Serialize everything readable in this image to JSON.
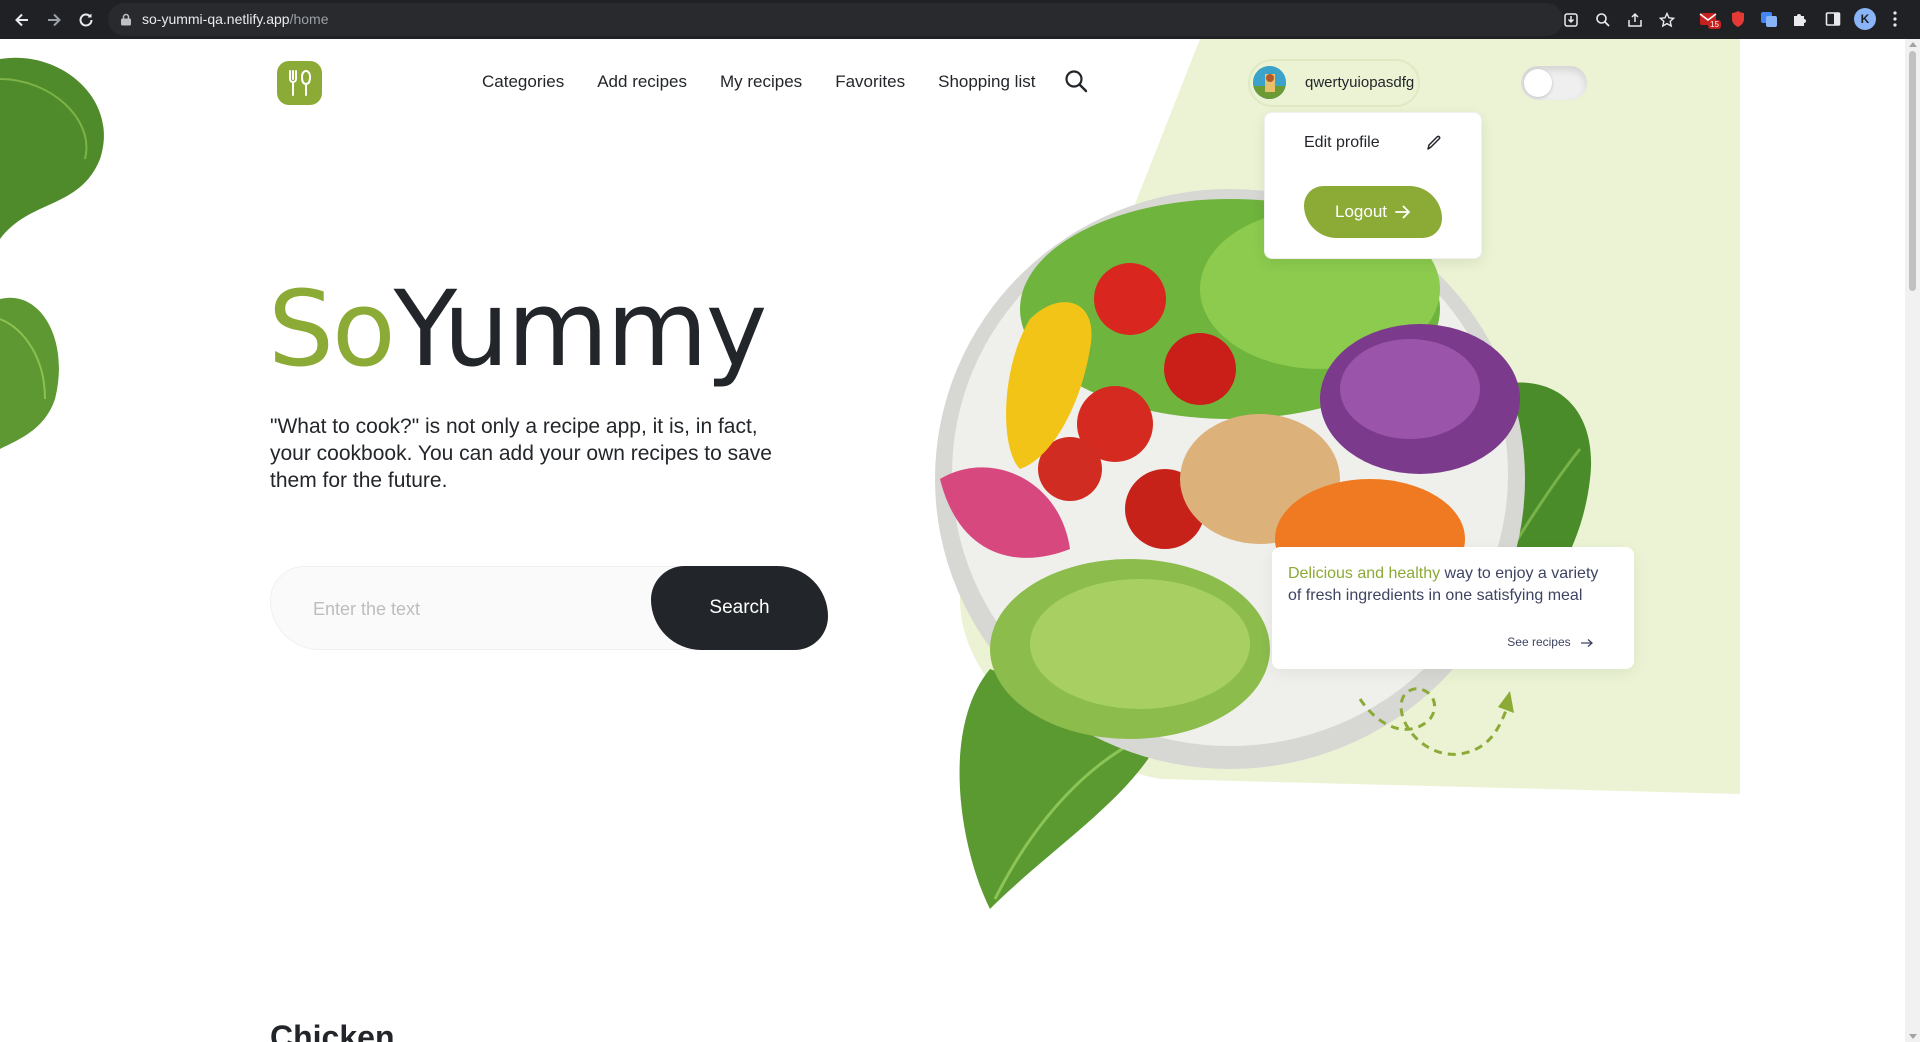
{
  "browser": {
    "url_host": "so-yummi-qa.netlify.app",
    "url_path": "/home",
    "extension_badge": "15",
    "profile_initial": "K"
  },
  "header": {
    "nav": [
      "Categories",
      "Add recipes",
      "My recipes",
      "Favorites",
      "Shopping list"
    ],
    "user_name": "qwertyuiopasdfg"
  },
  "user_menu": {
    "edit_label": "Edit profile",
    "logout_label": "Logout"
  },
  "hero": {
    "title_part1": "So",
    "title_part2": "Yummy",
    "description": "\"What to cook?\" is not only a recipe app, it is, in fact, your cookbook. You can add your own recipes to save them for the future.",
    "search_placeholder": "Enter the text",
    "search_button": "Search"
  },
  "info_card": {
    "accent_text": "Delicious and healthy",
    "rest_text": " way to enjoy a variety of fresh ingredients in one satisfying meal",
    "link_label": "See recipes"
  },
  "next_section_title": "Chicken",
  "colors": {
    "accent": "#8baa36",
    "dark": "#22252a",
    "light_green": "#ebf3d4"
  }
}
